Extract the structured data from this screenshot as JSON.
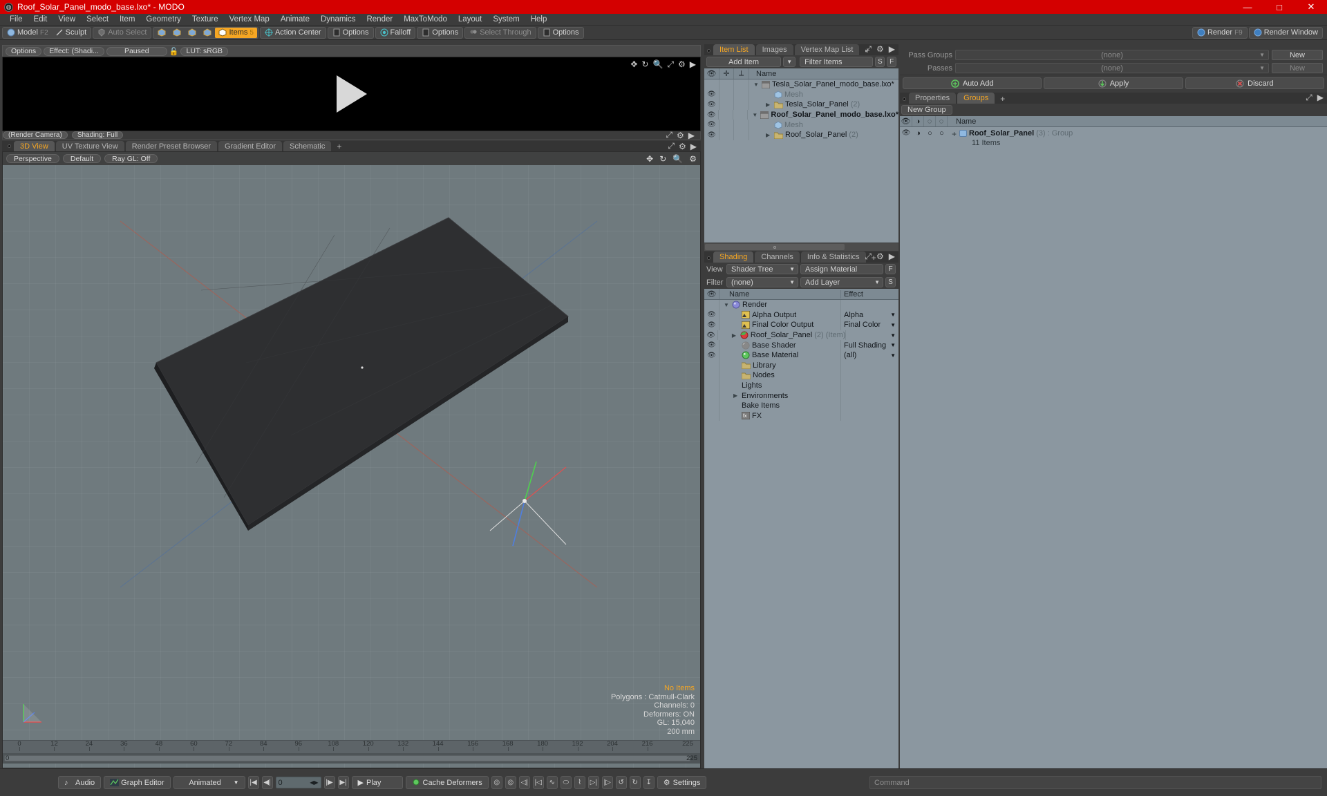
{
  "window": {
    "title": "Roof_Solar_Panel_modo_base.lxo* - MODO",
    "minimize": "—",
    "maximize": "□",
    "close": "✕"
  },
  "menubar": [
    "File",
    "Edit",
    "View",
    "Select",
    "Item",
    "Geometry",
    "Texture",
    "Vertex Map",
    "Animate",
    "Dynamics",
    "Render",
    "MaxToModo",
    "Layout",
    "System",
    "Help"
  ],
  "modebar": {
    "model": "Model",
    "model_key": "F2",
    "sculpt": "Sculpt",
    "auto_select": "Auto Select",
    "items": "Items",
    "items_badge": "5",
    "action_center": "Action Center",
    "options1": "Options",
    "falloff": "Falloff",
    "options2": "Options",
    "select_through": "Select Through",
    "options3": "Options",
    "render": "Render",
    "render_key": "F9",
    "render_window": "Render Window"
  },
  "render_pane": {
    "options": "Options",
    "effect": "Effect: (Shadi...",
    "paused": "Paused",
    "lut": "LUT: sRGB",
    "render_camera": "(Render Camera)",
    "shading": "Shading: Full"
  },
  "viewport": {
    "tabs": [
      {
        "label": "3D View",
        "active": true
      },
      {
        "label": "UV Texture View",
        "active": false
      },
      {
        "label": "Render Preset Browser",
        "active": false
      },
      {
        "label": "Gradient Editor",
        "active": false
      },
      {
        "label": "Schematic",
        "active": false
      }
    ],
    "tab_plus": "+",
    "perspective": "Perspective",
    "default": "Default",
    "raygl": "Ray GL: Off",
    "info": {
      "no_items": "No Items",
      "polygons": "Polygons : Catmull-Clark",
      "channels": "Channels: 0",
      "deformers": "Deformers: ON",
      "gl": "GL: 15,040",
      "scale": "200 mm"
    },
    "ruler_ticks": [
      "0",
      "12",
      "24",
      "36",
      "48",
      "60",
      "72",
      "84",
      "96",
      "108",
      "120",
      "132",
      "144",
      "156",
      "168",
      "180",
      "192",
      "204",
      "216"
    ],
    "scrub_start": "0",
    "scrub_end": "225",
    "ruler_end": "225"
  },
  "item_list": {
    "tabs": [
      {
        "label": "Item List",
        "active": true
      },
      {
        "label": "Images",
        "active": false
      },
      {
        "label": "Vertex Map List",
        "active": false
      }
    ],
    "tab_plus": "+",
    "add_item": "Add Item",
    "filter_items": "Filter Items",
    "btn_s": "S",
    "btn_f": "F",
    "col_name": "Name",
    "rows": [
      {
        "name": "Tesla_Solar_Panel_modo_base.lxo*",
        "suffix": "",
        "indent": 0,
        "icon": "film-icon",
        "bold": false,
        "expander": "▼",
        "eye": false
      },
      {
        "name": "Mesh",
        "suffix": "",
        "indent": 1,
        "icon": "cube-icon",
        "bold": false,
        "expander": "",
        "eye": true,
        "dim": true
      },
      {
        "name": "Tesla_Solar_Panel",
        "suffix": "(2)",
        "indent": 1,
        "icon": "folder-icon",
        "bold": false,
        "expander": "▶",
        "eye": true
      },
      {
        "name": "Roof_Solar_Panel_modo_base.lxo*",
        "suffix": "",
        "indent": 0,
        "icon": "film-icon",
        "bold": true,
        "expander": "▼",
        "eye": true
      },
      {
        "name": "Mesh",
        "suffix": "",
        "indent": 1,
        "icon": "cube-icon",
        "bold": false,
        "expander": "",
        "eye": true,
        "dim": true
      },
      {
        "name": "Roof_Solar_Panel",
        "suffix": "(2)",
        "indent": 1,
        "icon": "folder-icon",
        "bold": false,
        "expander": "▶",
        "eye": true
      }
    ]
  },
  "shading": {
    "tabs": [
      {
        "label": "Shading",
        "active": true
      },
      {
        "label": "Channels",
        "active": false
      },
      {
        "label": "Info & Statistics",
        "active": false
      }
    ],
    "tab_plus": "+",
    "view_label": "View",
    "view_value": "Shader Tree",
    "assign_material": "Assign Material",
    "btn_f": "F",
    "filter_label": "Filter",
    "filter_value": "(none)",
    "add_layer": "Add Layer",
    "btn_s": "S",
    "col_name": "Name",
    "col_effect": "Effect",
    "rows": [
      {
        "name": "Render",
        "suffix": "",
        "effect": "",
        "indent": 0,
        "icon": "sphere-icon",
        "expander": "▼",
        "eye": false,
        "dropdown": false
      },
      {
        "name": "Alpha Output",
        "suffix": "",
        "effect": "Alpha",
        "indent": 1,
        "icon": "image-icon",
        "expander": "",
        "eye": true,
        "dropdown": true
      },
      {
        "name": "Final Color Output",
        "suffix": "",
        "effect": "Final Color",
        "indent": 1,
        "icon": "image-icon",
        "expander": "",
        "eye": true,
        "dropdown": true
      },
      {
        "name": "Roof_Solar_Panel",
        "suffix": "(2) (Item)",
        "effect": "",
        "indent": 1,
        "icon": "material-icon",
        "expander": "▶",
        "eye": true,
        "dropdown": true
      },
      {
        "name": "Base Shader",
        "suffix": "",
        "effect": "Full Shading",
        "indent": 1,
        "icon": "shader-icon",
        "expander": "",
        "eye": true,
        "dropdown": true
      },
      {
        "name": "Base Material",
        "suffix": "",
        "effect": "(all)",
        "indent": 1,
        "icon": "greenball-icon",
        "expander": "",
        "eye": true,
        "dropdown": true
      },
      {
        "name": "Library",
        "suffix": "",
        "effect": "",
        "indent": 1,
        "icon": "folder-icon",
        "expander": "",
        "eye": false,
        "dropdown": false
      },
      {
        "name": "Nodes",
        "suffix": "",
        "effect": "",
        "indent": 1,
        "icon": "folder-icon",
        "expander": "",
        "eye": false,
        "dropdown": false
      },
      {
        "name": "Lights",
        "suffix": "",
        "effect": "",
        "indent": 1,
        "icon": "",
        "expander": "",
        "eye": false,
        "dropdown": false
      },
      {
        "name": "Environments",
        "suffix": "",
        "effect": "",
        "indent": 1,
        "icon": "",
        "expander": "▶",
        "eye": false,
        "dropdown": false
      },
      {
        "name": "Bake Items",
        "suffix": "",
        "effect": "",
        "indent": 1,
        "icon": "",
        "expander": "",
        "eye": false,
        "dropdown": false
      },
      {
        "name": "FX",
        "suffix": "",
        "effect": "",
        "indent": 1,
        "icon": "fx-icon",
        "expander": "",
        "eye": false,
        "dropdown": false
      }
    ]
  },
  "passes": {
    "pass_groups_label": "Pass Groups",
    "pass_groups_value": "(none)",
    "pass_groups_new": "New",
    "passes_label": "Passes",
    "passes_value": "(none)",
    "passes_new": "New",
    "auto_add": "Auto Add",
    "apply": "Apply",
    "discard": "Discard"
  },
  "groups": {
    "tabs": [
      {
        "label": "Properties",
        "active": false
      },
      {
        "label": "Groups",
        "active": true
      }
    ],
    "tab_plus": "+",
    "new_group": "New Group",
    "col_name": "Name",
    "row": {
      "name": "Roof_Solar_Panel",
      "count": "(3)",
      "type": ": Group",
      "items": "11 Items",
      "plus": "+"
    }
  },
  "bottombar": {
    "audio": "Audio",
    "graph_editor": "Graph Editor",
    "animated": "Animated",
    "frame": "0",
    "play": "Play",
    "cache_deformers": "Cache Deformers",
    "settings": "Settings"
  },
  "command": {
    "placeholder": "Command"
  },
  "colors": {
    "accent": "#f5a623",
    "titlebar": "#d40000",
    "panel": "#3c3c3c",
    "list": "#8b97a0",
    "header": "#7d8a93",
    "viewport": "#6f7a7e"
  }
}
